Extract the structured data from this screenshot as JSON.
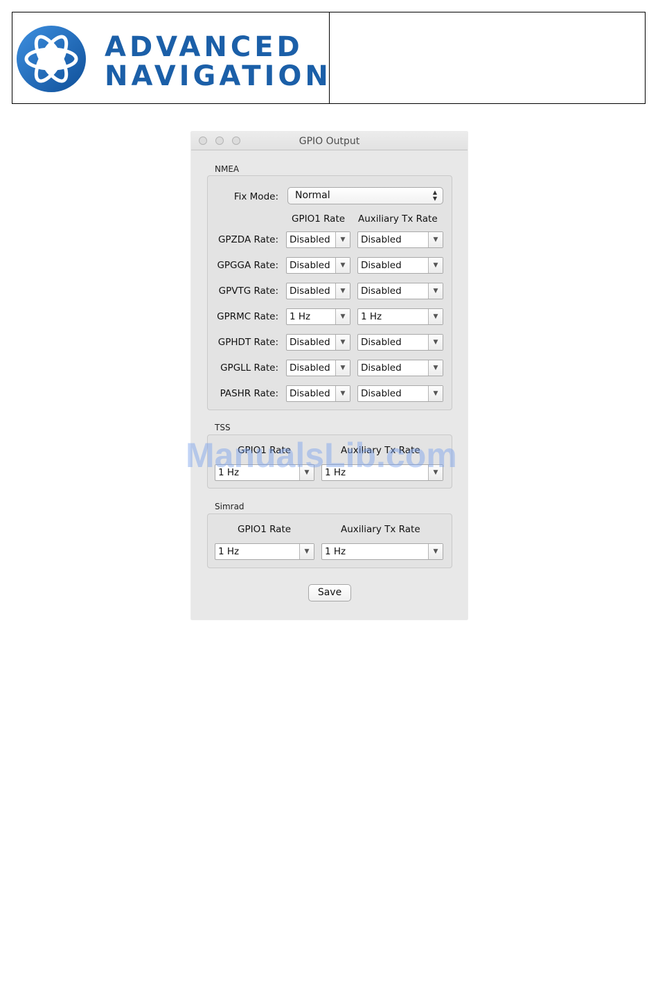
{
  "header": {
    "logo_line1": "ADVANCED",
    "logo_line2": "NAVIGATION",
    "brand_color": "#1b5fa8"
  },
  "window": {
    "title": "GPIO Output",
    "nmea": {
      "label": "NMEA",
      "fix_mode_label": "Fix Mode:",
      "fix_mode_value": "Normal",
      "col_gpio1": "GPIO1 Rate",
      "col_aux": "Auxiliary Tx Rate",
      "rows": [
        {
          "label": "GPZDA Rate:",
          "gpio1": "Disabled",
          "aux": "Disabled"
        },
        {
          "label": "GPGGA Rate:",
          "gpio1": "Disabled",
          "aux": "Disabled"
        },
        {
          "label": "GPVTG Rate:",
          "gpio1": "Disabled",
          "aux": "Disabled"
        },
        {
          "label": "GPRMC Rate:",
          "gpio1": "1 Hz",
          "aux": "1 Hz"
        },
        {
          "label": "GPHDT Rate:",
          "gpio1": "Disabled",
          "aux": "Disabled"
        },
        {
          "label": "GPGLL Rate:",
          "gpio1": "Disabled",
          "aux": "Disabled"
        },
        {
          "label": "PASHR Rate:",
          "gpio1": "Disabled",
          "aux": "Disabled"
        }
      ]
    },
    "tss": {
      "label": "TSS",
      "col_gpio1": "GPIO1 Rate",
      "col_aux": "Auxiliary Tx Rate",
      "gpio1": "1 Hz",
      "aux": "1 Hz"
    },
    "simrad": {
      "label": "Simrad",
      "col_gpio1": "GPIO1 Rate",
      "col_aux": "Auxiliary Tx Rate",
      "gpio1": "1 Hz",
      "aux": "1 Hz"
    },
    "save_label": "Save"
  },
  "watermark": "ManualsLib.com"
}
